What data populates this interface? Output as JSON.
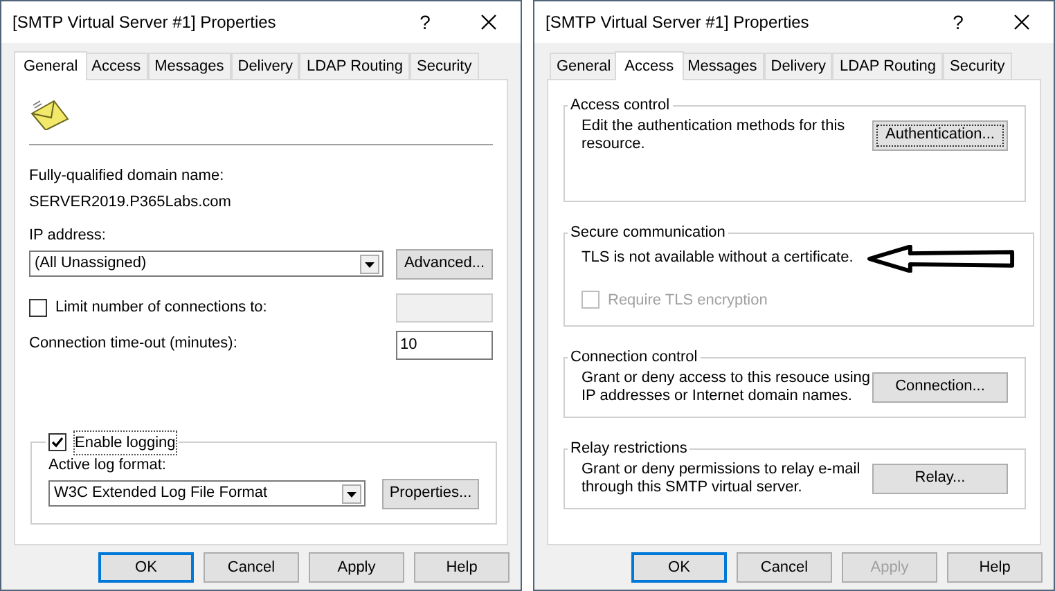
{
  "dialogs": [
    {
      "title": "[SMTP Virtual Server #1] Properties",
      "help": "?",
      "tabs": [
        {
          "label": "General",
          "selected": true
        },
        {
          "label": "Access",
          "selected": false
        },
        {
          "label": "Messages",
          "selected": false
        },
        {
          "label": "Delivery",
          "selected": false
        },
        {
          "label": "LDAP Routing",
          "selected": false
        },
        {
          "label": "Security",
          "selected": false
        }
      ],
      "content": {
        "kind": "general",
        "fqdn_label": "Fully-qualified domain name:",
        "fqdn": "SERVER2019.P365Labs.com",
        "ip_label": "IP address:",
        "ip_value": "(All Unassigned)",
        "advanced_button": "Advanced...",
        "limit": {
          "label": "Limit number of connections to:",
          "checked": false
        },
        "timeout_label": "Connection time-out (minutes):",
        "timeout_value": "10",
        "logging": {
          "label": "Enable logging",
          "checked": true
        },
        "log_format_label": "Active log format:",
        "log_format": "W3C Extended Log File Format",
        "properties_button": "Properties..."
      },
      "buttons": [
        {
          "label": "OK",
          "default": true,
          "disabled": false
        },
        {
          "label": "Cancel",
          "default": false,
          "disabled": false
        },
        {
          "label": "Apply",
          "default": false,
          "disabled": false
        },
        {
          "label": "Help",
          "default": false,
          "disabled": false
        }
      ]
    },
    {
      "title": "[SMTP Virtual Server #1] Properties",
      "help": "?",
      "tabs": [
        {
          "label": "General",
          "selected": false
        },
        {
          "label": "Access",
          "selected": true
        },
        {
          "label": "Messages",
          "selected": false
        },
        {
          "label": "Delivery",
          "selected": false
        },
        {
          "label": "LDAP Routing",
          "selected": false
        },
        {
          "label": "Security",
          "selected": false
        }
      ],
      "content": {
        "kind": "access",
        "groups": [
          {
            "title": "Access control",
            "text": "Edit the authentication methods for this resource.",
            "button": "Authentication..."
          },
          {
            "title": "Secure communication",
            "text": "TLS is not available without a certificate.",
            "checkbox": {
              "label": "Require TLS encryption",
              "checked": false,
              "disabled": true
            }
          },
          {
            "title": "Connection control",
            "text": "Grant or deny access to this resouce using IP addresses or Internet domain names.",
            "button": "Connection..."
          },
          {
            "title": "Relay restrictions",
            "text": "Grant or deny permissions to relay e-mail through this SMTP virtual server.",
            "button": "Relay..."
          }
        ]
      },
      "buttons": [
        {
          "label": "OK",
          "default": true,
          "disabled": false
        },
        {
          "label": "Cancel",
          "default": false,
          "disabled": false
        },
        {
          "label": "Apply",
          "default": false,
          "disabled": true
        },
        {
          "label": "Help",
          "default": false,
          "disabled": false
        }
      ]
    }
  ]
}
